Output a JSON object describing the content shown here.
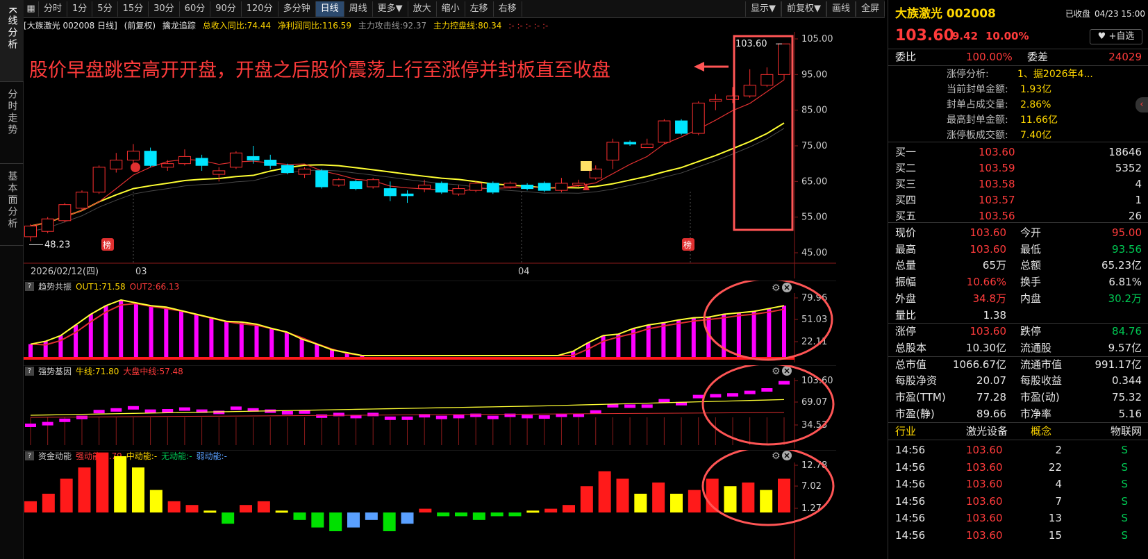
{
  "left_tabs": [
    {
      "label": "K线分析"
    },
    {
      "label": "分时走势"
    },
    {
      "label": "基本面分析"
    }
  ],
  "toolbar": {
    "items": [
      "分时",
      "1分",
      "5分",
      "15分",
      "30分",
      "60分",
      "90分",
      "120分",
      "多分钟",
      "日线",
      "周线",
      "更多▼",
      "放大",
      "缩小",
      "左移",
      "右移"
    ],
    "active": "日线",
    "right_items": [
      "显示▼",
      "前复权▼",
      "画线",
      "全屏"
    ]
  },
  "header": {
    "stock_label": "[大族激光 002008 日线]",
    "adjust": "(前复权)",
    "indicator": "擒龙追踪",
    "revenue": "总收入同比:74.44",
    "profit": "净利润同比:116.59",
    "attack": "主力攻击线:92.37",
    "control": "主力控盘线:80.34",
    "dots": ":- :- :- :- :-"
  },
  "annotation": "股价早盘跳空高开开盘，开盘之后股价震荡上行至涨停并封板直至收盘",
  "main_chart": {
    "y_ticks": [
      "105.00",
      "95.00",
      "85.00",
      "75.00",
      "65.00",
      "55.00",
      "45.00"
    ],
    "date_label": "2026/02/12(四)",
    "month_labels": [
      "03",
      "04"
    ],
    "low_label": "48.23",
    "high_label": "103.60",
    "bang_label": "榜"
  },
  "chart_data": {
    "type": "candlestick",
    "ylim": [
      45,
      105
    ],
    "candles": [
      {
        "o": 49.5,
        "c": 52.5,
        "h": 53.0,
        "l": 48.23
      },
      {
        "o": 51.0,
        "c": 54.5,
        "h": 55.0,
        "l": 50.5
      },
      {
        "o": 54.0,
        "c": 58.5,
        "h": 59.0,
        "l": 53.5
      },
      {
        "o": 57.5,
        "c": 62.0,
        "h": 62.5,
        "l": 57.0
      },
      {
        "o": 62.0,
        "c": 69.0,
        "h": 69.5,
        "l": 61.5
      },
      {
        "o": 68.5,
        "c": 71.0,
        "h": 73.0,
        "l": 67.5
      },
      {
        "o": 71.0,
        "c": 73.5,
        "h": 75.5,
        "l": 70.0
      },
      {
        "o": 73.5,
        "c": 69.5,
        "h": 74.5,
        "l": 69.0
      },
      {
        "o": 69.0,
        "c": 70.0,
        "h": 71.0,
        "l": 68.0
      },
      {
        "o": 70.0,
        "c": 72.0,
        "h": 74.0,
        "l": 69.5
      },
      {
        "o": 71.5,
        "c": 69.5,
        "h": 72.5,
        "l": 68.0
      },
      {
        "o": 67.0,
        "c": 68.0,
        "h": 69.0,
        "l": 65.0
      },
      {
        "o": 69.0,
        "c": 73.0,
        "h": 73.5,
        "l": 68.5
      },
      {
        "o": 72.0,
        "c": 71.0,
        "h": 75.0,
        "l": 70.0
      },
      {
        "o": 71.0,
        "c": 69.5,
        "h": 72.5,
        "l": 68.5
      },
      {
        "o": 69.5,
        "c": 67.5,
        "h": 70.0,
        "l": 67.0
      },
      {
        "o": 67.0,
        "c": 68.5,
        "h": 69.0,
        "l": 66.0
      },
      {
        "o": 68.0,
        "c": 63.5,
        "h": 68.5,
        "l": 63.0
      },
      {
        "o": 64.0,
        "c": 65.5,
        "h": 66.0,
        "l": 63.5
      },
      {
        "o": 65.0,
        "c": 63.0,
        "h": 65.5,
        "l": 62.5
      },
      {
        "o": 63.5,
        "c": 65.5,
        "h": 66.0,
        "l": 63.0
      },
      {
        "o": 63.0,
        "c": 61.0,
        "h": 65.0,
        "l": 59.5
      },
      {
        "o": 61.5,
        "c": 61.0,
        "h": 62.5,
        "l": 59.0
      },
      {
        "o": 63.0,
        "c": 64.0,
        "h": 65.5,
        "l": 62.0
      },
      {
        "o": 64.5,
        "c": 62.0,
        "h": 65.0,
        "l": 61.5
      },
      {
        "o": 61.5,
        "c": 63.0,
        "h": 64.0,
        "l": 61.0
      },
      {
        "o": 62.5,
        "c": 64.5,
        "h": 65.0,
        "l": 62.0
      },
      {
        "o": 64.5,
        "c": 62.0,
        "h": 65.0,
        "l": 61.5
      },
      {
        "o": 63.5,
        "c": 64.5,
        "h": 65.0,
        "l": 63.0
      },
      {
        "o": 64.0,
        "c": 63.0,
        "h": 64.5,
        "l": 62.5
      },
      {
        "o": 64.5,
        "c": 62.5,
        "h": 65.0,
        "l": 62.0
      },
      {
        "o": 62.5,
        "c": 64.5,
        "h": 66.0,
        "l": 62.0
      },
      {
        "o": 64.0,
        "c": 64.5,
        "h": 65.5,
        "l": 63.5
      },
      {
        "o": 66.0,
        "c": 68.5,
        "h": 69.5,
        "l": 65.5
      },
      {
        "o": 71.0,
        "c": 76.0,
        "h": 77.0,
        "l": 68.5
      },
      {
        "o": 76.0,
        "c": 75.5,
        "h": 76.5,
        "l": 75.0
      },
      {
        "o": 74.5,
        "c": 75.5,
        "h": 77.0,
        "l": 74.5
      },
      {
        "o": 76.0,
        "c": 82.0,
        "h": 82.5,
        "l": 75.5
      },
      {
        "o": 82.0,
        "c": 78.5,
        "h": 82.5,
        "l": 78.0
      },
      {
        "o": 78.5,
        "c": 87.0,
        "h": 87.5,
        "l": 78.0
      },
      {
        "o": 87.5,
        "c": 88.0,
        "h": 89.5,
        "l": 85.0
      },
      {
        "o": 88.0,
        "c": 89.0,
        "h": 91.5,
        "l": 87.0
      },
      {
        "o": 89.0,
        "c": 92.0,
        "h": 96.5,
        "l": 88.5
      },
      {
        "o": 92.0,
        "c": 95.0,
        "h": 97.0,
        "l": 91.5
      },
      {
        "o": 95.0,
        "c": 103.6,
        "h": 103.6,
        "l": 93.56
      }
    ],
    "ma_red_ends": [
      49.0,
      92.37
    ],
    "ma_yellow_ends": [
      48.5,
      80.34
    ]
  },
  "panels": {
    "trend": {
      "name": "趋势共振",
      "out1": "OUT1:71.58",
      "out2": "OUT2:66.13",
      "y_ticks": [
        "79.96",
        "51.03",
        "22.11"
      ],
      "values": [
        18,
        22,
        30,
        45,
        60,
        72,
        80,
        76,
        72,
        70,
        65,
        60,
        55,
        50,
        49,
        46,
        40,
        35,
        25,
        18,
        10,
        6,
        2,
        0,
        0,
        0,
        0,
        0,
        0,
        0,
        0,
        0,
        0,
        0,
        0,
        0,
        8,
        20,
        30,
        32,
        40,
        45,
        48,
        52,
        55,
        56,
        60,
        62,
        64,
        68,
        72
      ]
    },
    "strong": {
      "name": "强势基因",
      "bull": "牛线:71.80",
      "mid": "大盘中线:57.48",
      "y_ticks": [
        "103.60",
        "69.07",
        "34.53"
      ]
    },
    "fund": {
      "name": "资金动能",
      "strong": "强动能:7.79",
      "mid": "中动能:-",
      "none": "无动能:-",
      "weak": "弱动能:-",
      "y_ticks": [
        "12.78",
        "7.02",
        "1.27"
      ]
    }
  },
  "quote": {
    "name": "大族激光 002008",
    "status": "已收盘",
    "time": "04/23 15:00",
    "price": "103.60",
    "change": "9.42",
    "pct": "10.00%",
    "watch": "+自选",
    "weibi_label": "委比",
    "weibi": "100.00%",
    "weicha_label": "委差",
    "weicha": "24029",
    "limit_analysis": [
      {
        "k": "涨停分析:",
        "v": "1、据2026年4..."
      },
      {
        "k": "当前封单金额:",
        "v": "1.93亿"
      },
      {
        "k": "封单占成交量:",
        "v": "2.86%"
      },
      {
        "k": "最高封单金额:",
        "v": "11.66亿"
      },
      {
        "k": "涨停板成交额:",
        "v": "7.40亿"
      }
    ],
    "bids": [
      {
        "k": "买一",
        "p": "103.60",
        "v": "18646"
      },
      {
        "k": "买二",
        "p": "103.59",
        "v": "5352"
      },
      {
        "k": "买三",
        "p": "103.58",
        "v": "4"
      },
      {
        "k": "买四",
        "p": "103.57",
        "v": "1"
      },
      {
        "k": "买五",
        "p": "103.56",
        "v": "26"
      }
    ],
    "stats": [
      {
        "k1": "现价",
        "v1": "103.60",
        "c1": "red",
        "k2": "今开",
        "v2": "95.00",
        "c2": "red"
      },
      {
        "k1": "最高",
        "v1": "103.60",
        "c1": "red",
        "k2": "最低",
        "v2": "93.56",
        "c2": "green"
      },
      {
        "k1": "总量",
        "v1": "65万",
        "c1": "white",
        "k2": "总额",
        "v2": "65.23亿",
        "c2": "white"
      },
      {
        "k1": "振幅",
        "v1": "10.66%",
        "c1": "red",
        "k2": "换手",
        "v2": "6.81%",
        "c2": "white"
      },
      {
        "k1": "外盘",
        "v1": "34.8万",
        "c1": "red",
        "k2": "内盘",
        "v2": "30.2万",
        "c2": "green"
      },
      {
        "k1": "量比",
        "v1": "1.38",
        "c1": "white",
        "k2": "",
        "v2": "",
        "c2": "white"
      },
      {
        "k1": "涨停",
        "v1": "103.60",
        "c1": "red",
        "k2": "跌停",
        "v2": "84.76",
        "c2": "green"
      },
      {
        "k1": "总股本",
        "v1": "10.30亿",
        "c1": "white",
        "k2": "流通股",
        "v2": "9.57亿",
        "c2": "white"
      },
      {
        "k1": "总市值",
        "v1": "1066.67亿",
        "c1": "white",
        "k2": "流通市值",
        "v2": "991.17亿",
        "c2": "white"
      },
      {
        "k1": "每股净资",
        "v1": "20.07",
        "c1": "white",
        "k2": "每股收益",
        "v2": "0.344",
        "c2": "white"
      },
      {
        "k1": "市盈(TTM)",
        "v1": "77.28",
        "c1": "white",
        "k2": "市盈(动)",
        "v2": "75.32",
        "c2": "white"
      },
      {
        "k1": "市盈(静)",
        "v1": "89.66",
        "c1": "white",
        "k2": "市净率",
        "v2": "5.16",
        "c2": "white"
      }
    ],
    "industry_label": "行业",
    "industry": "激光设备",
    "concept_label": "概念",
    "concept": "物联网",
    "ticks": [
      {
        "t": "14:56",
        "p": "103.60",
        "v": "2",
        "s": "S"
      },
      {
        "t": "14:56",
        "p": "103.60",
        "v": "22",
        "s": "S"
      },
      {
        "t": "14:56",
        "p": "103.60",
        "v": "4",
        "s": "S"
      },
      {
        "t": "14:56",
        "p": "103.60",
        "v": "7",
        "s": "S"
      },
      {
        "t": "14:56",
        "p": "103.60",
        "v": "13",
        "s": "S"
      },
      {
        "t": "14:56",
        "p": "103.60",
        "v": "15",
        "s": "S"
      }
    ]
  }
}
